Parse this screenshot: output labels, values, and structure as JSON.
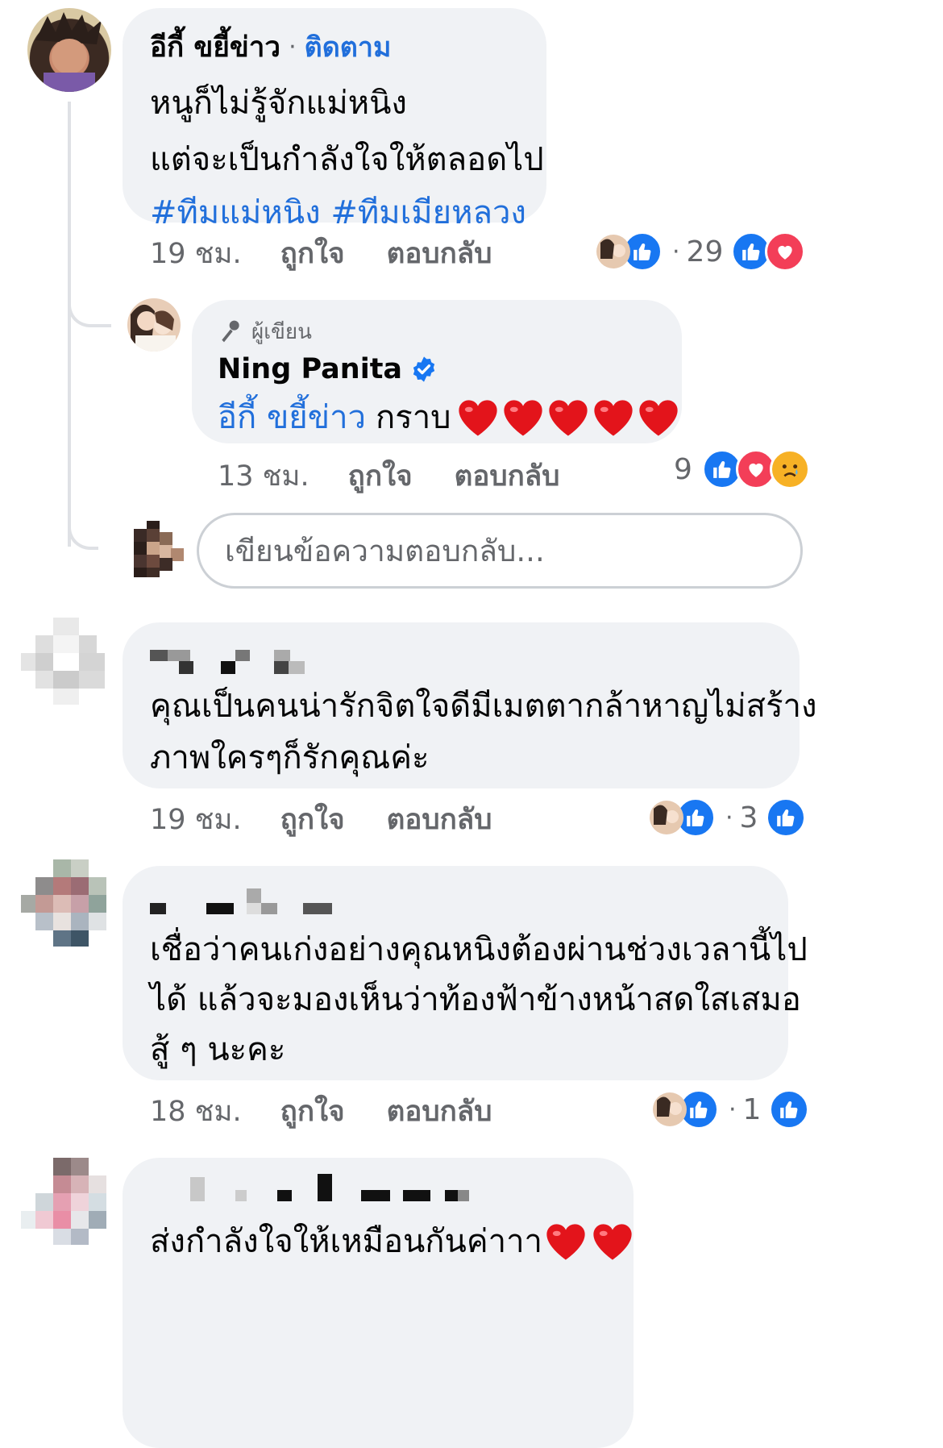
{
  "comments": [
    {
      "author": "อีกี้ ขยี้ข่าว",
      "separator": "·",
      "follow_label": "ติดตาม",
      "lines": [
        "หนูก็ไม่รู้จักแม่หนิง",
        "แต่จะเป็นกำลังใจให้ตลอดไป"
      ],
      "hashtags": "#ทีมแม่หนิง #ทีมเมียหลวง",
      "time": "19 ชม.",
      "like_label": "ถูกใจ",
      "reply_label": "ตอบกลับ",
      "reaction_count": "29",
      "reactions": [
        "like",
        "love"
      ],
      "author_liked": "like"
    },
    {
      "author": "",
      "lines": [
        "คุณเป็นคนน่ารักจิตใจดีมีเมตตากล้าหาญไม่สร้าง",
        "ภาพใครๆก็รักคุณค่ะ"
      ],
      "time": "19 ชม.",
      "like_label": "ถูกใจ",
      "reply_label": "ตอบกลับ",
      "reaction_count": "3",
      "reactions": [
        "like"
      ]
    },
    {
      "author": "",
      "lines": [
        "เชื่อว่าคนเก่งอย่างคุณหนิงต้องผ่านช่วงเวลานี้ไป",
        "ได้ แล้วจะมองเห็นว่าท้องฟ้าข้างหน้าสดใสเสมอ",
        "สู้ ๆ นะคะ"
      ],
      "time": "18 ชม.",
      "like_label": "ถูกใจ",
      "reply_label": "ตอบกลับ",
      "reaction_count": "1",
      "reactions": [
        "like"
      ]
    },
    {
      "author": "",
      "lines": [
        "ส่งกำลังใจให้เหมือนกันค่าาา"
      ]
    }
  ],
  "reply": {
    "badge": "ผู้เขียน",
    "author": "Ning Panita",
    "mention": "อีกี้ ขยี้ข่าว",
    "text": "กราบ",
    "hearts": 5,
    "time": "13 ชม.",
    "like_label": "ถูกใจ",
    "reply_label": "ตอบกลับ",
    "reaction_count": "9",
    "reactions": [
      "like",
      "love",
      "sad"
    ]
  },
  "reply_input": {
    "placeholder": "เขียนข้อความตอบกลับ..."
  },
  "colors": {
    "link": "#216fdb",
    "like": "#1877f2",
    "love": "#f33e58",
    "bubble": "#f0f2f5",
    "meta": "#65676b",
    "verified": "#1877f2"
  },
  "icons": {
    "like": "thumbs-up-icon",
    "love": "heart-icon",
    "sad": "sad-face-icon",
    "verified": "verified-badge-icon",
    "author_badge": "microphone-icon"
  }
}
